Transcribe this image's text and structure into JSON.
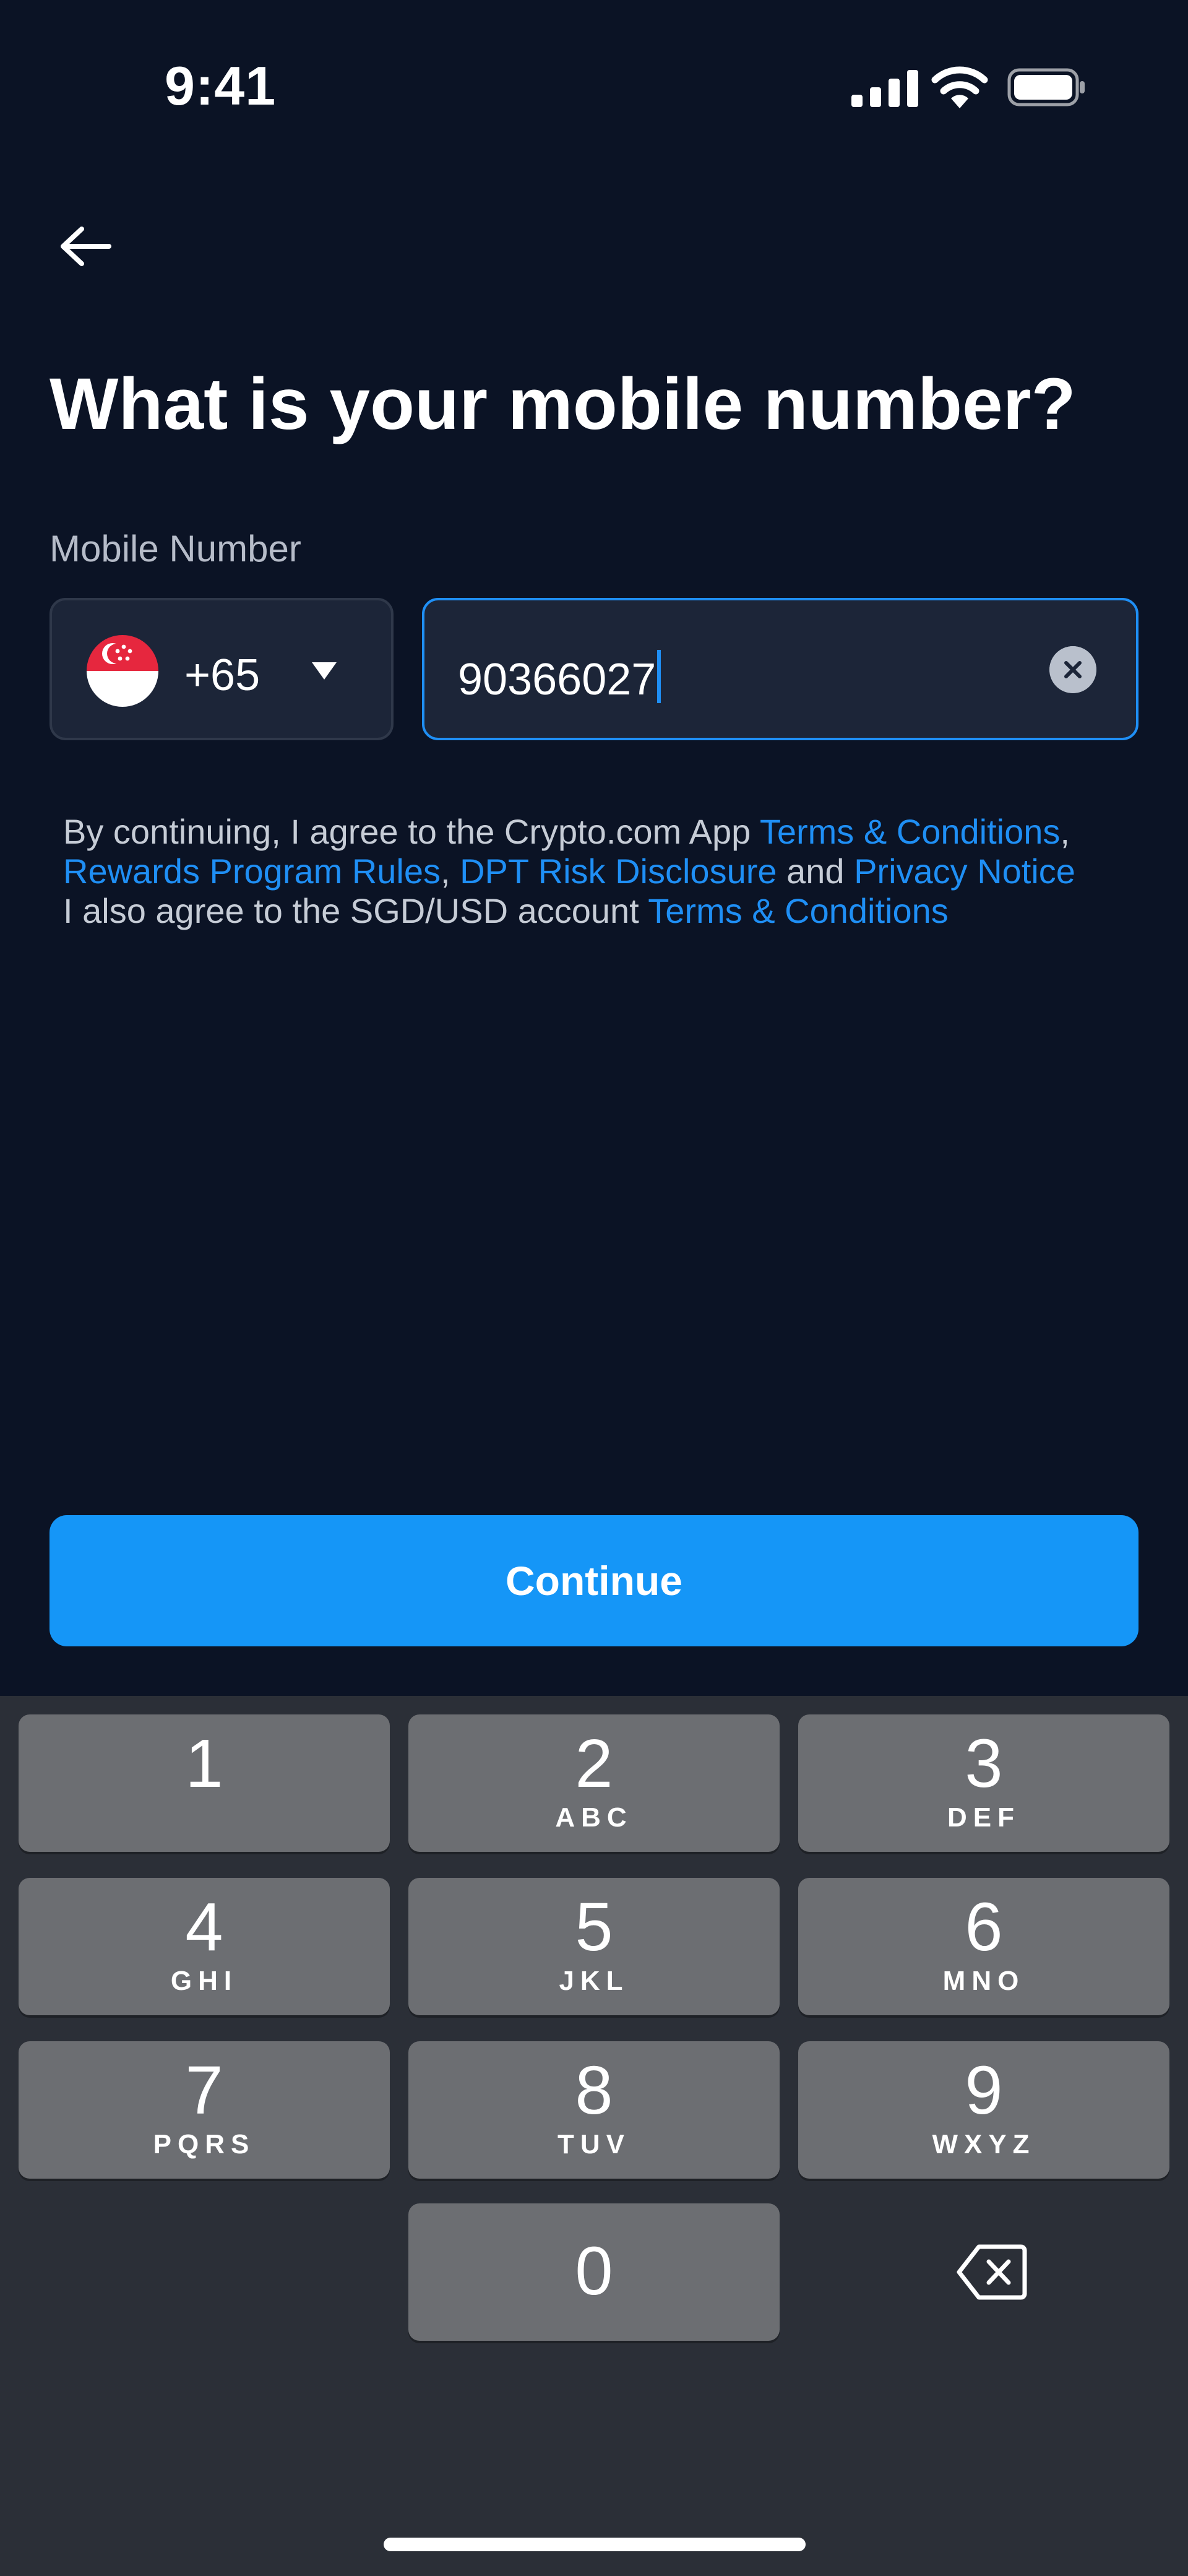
{
  "status_bar": {
    "time": "9:41",
    "icons": [
      "cellular-signal-icon",
      "wifi-icon",
      "battery-icon"
    ]
  },
  "header": {
    "back_icon": "arrow-left-icon",
    "title": "What is your mobile number?"
  },
  "form": {
    "label": "Mobile Number",
    "country": {
      "flag": "singapore-flag-icon",
      "code": "+65"
    },
    "phone_value": "90366027"
  },
  "legal": {
    "text1": "By continuing, I agree to the Crypto.com App ",
    "link_terms": "Terms & Conditions",
    "sep1": ",",
    "link_rewards": "Rewards Program Rules",
    "sep2": ", ",
    "link_dpt": "DPT Risk Disclosure",
    "and": " and ",
    "link_privacy": "Privacy Notice",
    "text2": "I also agree to the SGD/USD account ",
    "link_account_terms": "Terms & Conditions"
  },
  "continue_label": "Continue",
  "keypad": [
    {
      "num": "1",
      "letters": ""
    },
    {
      "num": "2",
      "letters": "ABC"
    },
    {
      "num": "3",
      "letters": "DEF"
    },
    {
      "num": "4",
      "letters": "GHI"
    },
    {
      "num": "5",
      "letters": "JKL"
    },
    {
      "num": "6",
      "letters": "MNO"
    },
    {
      "num": "7",
      "letters": "PQRS"
    },
    {
      "num": "8",
      "letters": "TUV"
    },
    {
      "num": "9",
      "letters": "WXYZ"
    },
    {
      "num": "0",
      "letters": ""
    }
  ],
  "colors": {
    "background": "#0b1325",
    "accent": "#1596f7",
    "field": "#1c2538",
    "keyboard": "#2b2f37",
    "key": "#6c6e72"
  }
}
